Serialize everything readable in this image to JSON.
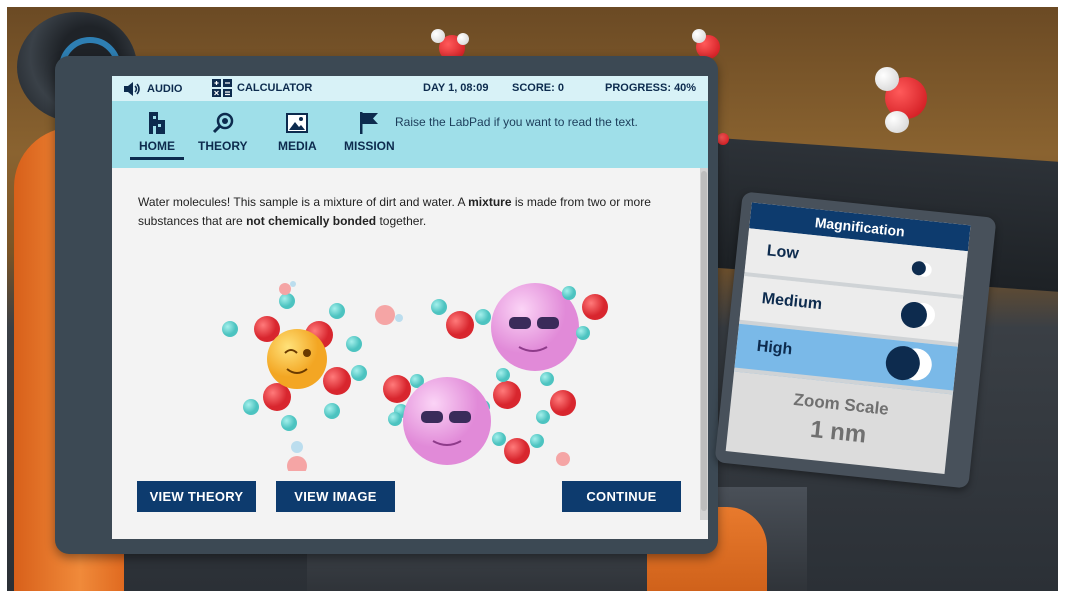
{
  "topbar": {
    "audio_label": "AUDIO",
    "calculator_label": "CALCULATOR",
    "day_time": "DAY 1, 08:09",
    "score": "SCORE: 0",
    "progress": "PROGRESS: 40%"
  },
  "tabs": [
    {
      "label": "HOME",
      "icon": "home-icon",
      "active": true
    },
    {
      "label": "THEORY",
      "icon": "magnifier-icon",
      "active": false
    },
    {
      "label": "MEDIA",
      "icon": "image-icon",
      "active": false
    },
    {
      "label": "MISSION",
      "icon": "flag-icon",
      "active": false
    }
  ],
  "hint": "Raise the LabPad if you want to read the text.",
  "content": {
    "part1": "Water molecules! This sample is a mixture of dirt and water. A ",
    "bold1": "mixture",
    "part2": " is made from two or more substances that are ",
    "bold2": "not chemically bonded",
    "part3": " together."
  },
  "buttons": {
    "view_theory": "VIEW THEORY",
    "view_image": "VIEW IMAGE",
    "continue": "CONTINUE"
  },
  "magnification": {
    "title": "Magnification",
    "options": [
      {
        "label": "Low",
        "selected": false
      },
      {
        "label": "Medium",
        "selected": false
      },
      {
        "label": "High",
        "selected": true
      }
    ],
    "zoom_label": "Zoom Scale",
    "zoom_value": "1 nm"
  },
  "colors": {
    "nav_dark": "#0d2b4e",
    "button_bg": "#0d3b6e",
    "nav_bg": "#9fdfe9",
    "selected_row": "#7ab9e8"
  }
}
